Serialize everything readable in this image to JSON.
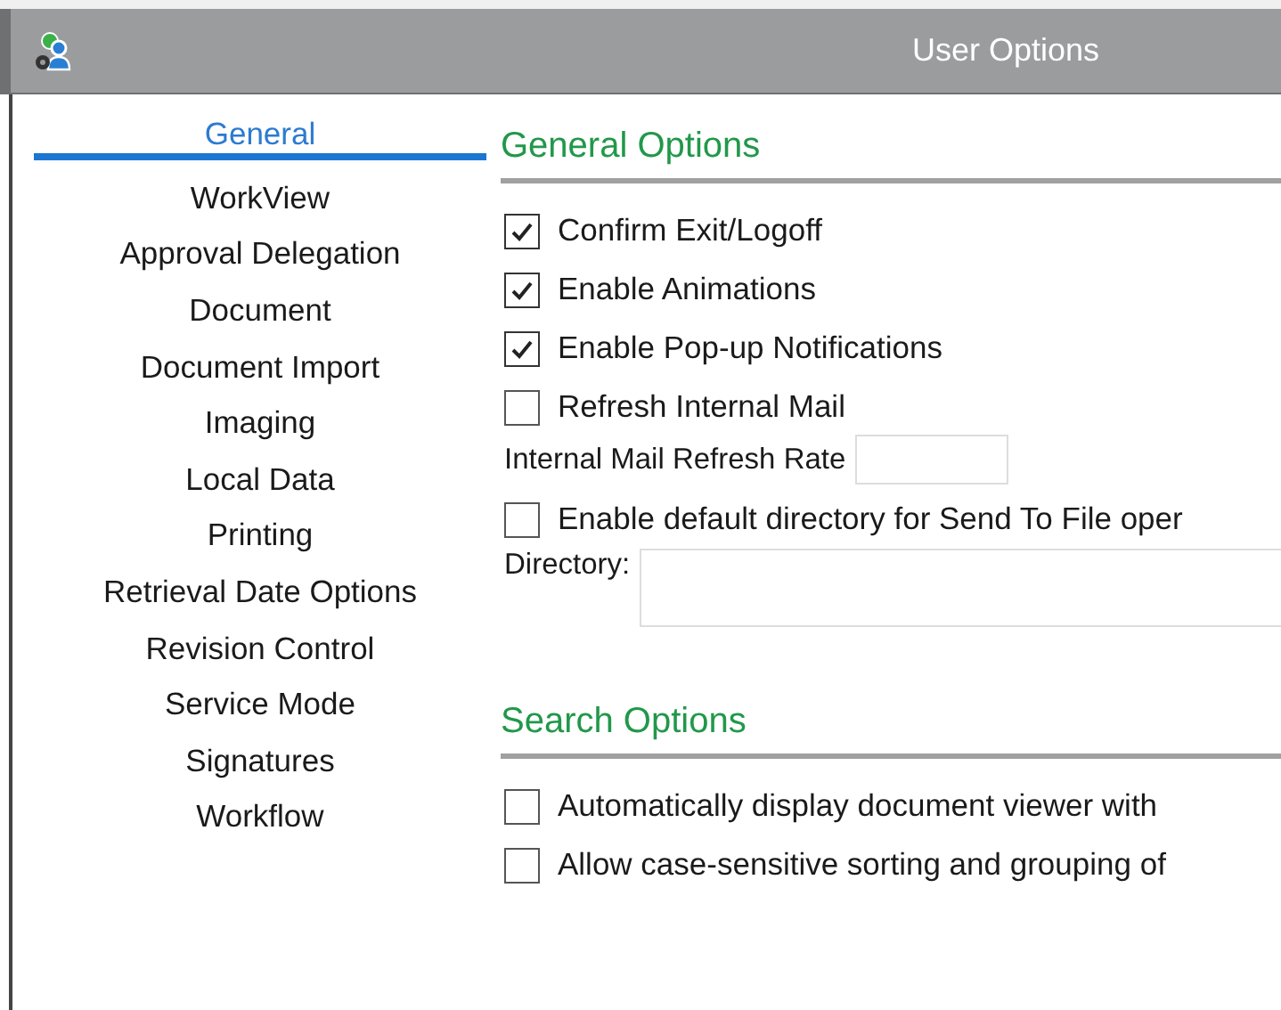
{
  "window": {
    "title": "User Options"
  },
  "sidebar": {
    "items": [
      {
        "label": "General",
        "selected": true
      },
      {
        "label": "WorkView",
        "selected": false
      },
      {
        "label": "Approval Delegation",
        "selected": false
      },
      {
        "label": "Document",
        "selected": false
      },
      {
        "label": "Document Import",
        "selected": false
      },
      {
        "label": "Imaging",
        "selected": false
      },
      {
        "label": "Local Data",
        "selected": false
      },
      {
        "label": "Printing",
        "selected": false
      },
      {
        "label": "Retrieval Date Options",
        "selected": false
      },
      {
        "label": "Revision Control",
        "selected": false
      },
      {
        "label": "Service Mode",
        "selected": false
      },
      {
        "label": "Signatures",
        "selected": false
      },
      {
        "label": "Workflow",
        "selected": false
      }
    ]
  },
  "sections": [
    {
      "title": "General Options",
      "items": [
        {
          "kind": "checkbox",
          "label": "Confirm Exit/Logoff",
          "checked": true
        },
        {
          "kind": "checkbox",
          "label": "Enable Animations",
          "checked": true
        },
        {
          "kind": "checkbox",
          "label": "Enable Pop-up Notifications",
          "checked": true
        },
        {
          "kind": "checkbox",
          "label": "Refresh Internal Mail",
          "checked": false
        },
        {
          "kind": "short-field",
          "label": "Internal Mail Refresh Rate"
        },
        {
          "kind": "checkbox",
          "label": "Enable default directory for Send To File oper",
          "checked": false
        },
        {
          "kind": "wide-field",
          "label": "Directory:"
        }
      ]
    },
    {
      "title": "Search Options",
      "items": [
        {
          "kind": "checkbox",
          "label": "Automatically display document viewer with",
          "checked": false
        },
        {
          "kind": "checkbox",
          "label": "Allow case-sensitive sorting and grouping of",
          "checked": false
        }
      ]
    }
  ]
}
